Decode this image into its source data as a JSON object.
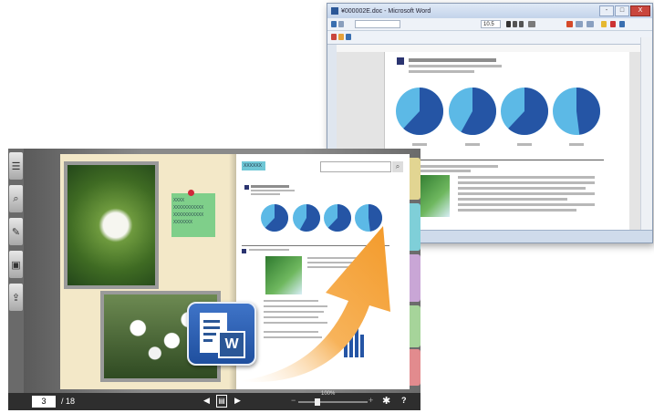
{
  "word_window": {
    "title": "¥000002E.doc - Microsoft Word",
    "font_size": "10.5",
    "buttons": {
      "minimize": "-",
      "maximize": "□",
      "close": "X"
    }
  },
  "word_doc": {
    "pie_fractions": [
      0.62,
      0.58,
      0.62,
      0.48
    ]
  },
  "viewer": {
    "page_current": "3",
    "page_total": "/ 18",
    "zoom_label": "100%",
    "zoom_minus": "−",
    "zoom_plus": "+",
    "settings_icon": "gear-icon",
    "help_label": "?",
    "prev_icon": "prev-triangle-icon",
    "next_icon": "next-triangle-icon",
    "sticky_note_lines": [
      "XXXX",
      "XXXXXXXXXXX",
      "XXXXXXXXXXX",
      "XXXXXXX"
    ],
    "search_tab_label": "XXXXXX",
    "toolbar_icons": [
      "list-icon",
      "zoom-page-icon",
      "pen-icon",
      "image-icon",
      "export-icon"
    ],
    "tab_colors": [
      "#e2d592",
      "#7fcfd8",
      "#c9a6d6",
      "#a6d49a",
      "#e28b8e"
    ]
  },
  "word_badge": {
    "letter": "W"
  },
  "colors": {
    "accent_orange": "#f5a23a",
    "pie_dark": "#2555a5",
    "pie_light": "#5cb9e6",
    "word_blue": "#2b5797"
  }
}
